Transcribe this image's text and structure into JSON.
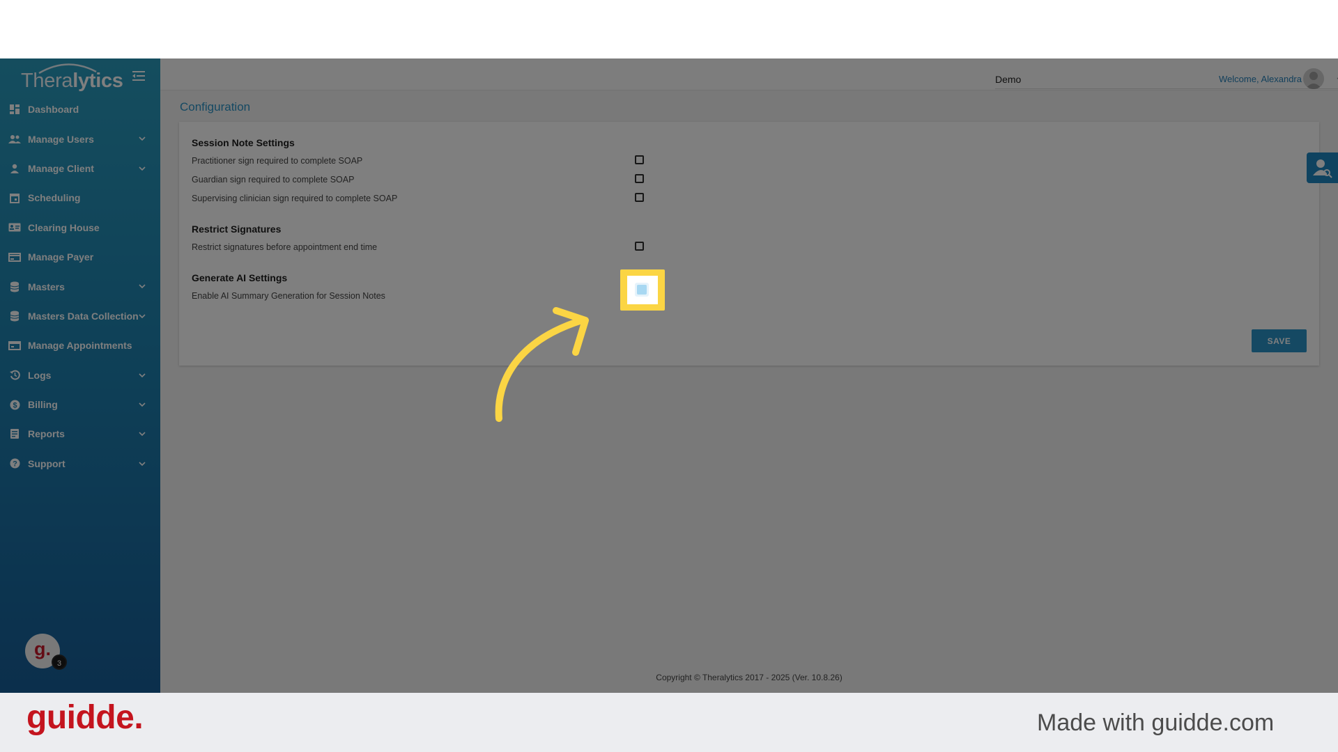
{
  "app": {
    "logo_prefix": "Thera",
    "logo_suffix": "lytics"
  },
  "sidebar": {
    "items": [
      {
        "label": "Dashboard",
        "icon": "dashboard-icon",
        "expandable": false
      },
      {
        "label": "Manage Users",
        "icon": "users-icon",
        "expandable": true
      },
      {
        "label": "Manage Client",
        "icon": "person-icon",
        "expandable": true
      },
      {
        "label": "Scheduling",
        "icon": "calendar-icon",
        "expandable": false
      },
      {
        "label": "Clearing House",
        "icon": "id-card-icon",
        "expandable": false
      },
      {
        "label": "Manage Payer",
        "icon": "payer-card-icon",
        "expandable": false
      },
      {
        "label": "Masters",
        "icon": "database-icon",
        "expandable": true
      },
      {
        "label": "Masters Data Collection",
        "icon": "database-icon",
        "expandable": true
      },
      {
        "label": "Manage Appointments",
        "icon": "appointments-icon",
        "expandable": false
      },
      {
        "label": "Logs",
        "icon": "history-icon",
        "expandable": true
      },
      {
        "label": "Billing",
        "icon": "dollar-icon",
        "expandable": true
      },
      {
        "label": "Reports",
        "icon": "report-icon",
        "expandable": true
      },
      {
        "label": "Support",
        "icon": "help-icon",
        "expandable": true
      }
    ],
    "avatar_letter": "g.",
    "avatar_badge": "3"
  },
  "header": {
    "organization": "Demo",
    "welcome": "Welcome, Alexandra"
  },
  "page": {
    "title": "Configuration"
  },
  "settings": {
    "session_note": {
      "title": "Session Note Settings",
      "options": [
        {
          "label": "Practitioner sign required to complete SOAP",
          "checked": false
        },
        {
          "label": "Guardian sign required to complete SOAP",
          "checked": false
        },
        {
          "label": "Supervising clinician sign required to complete SOAP",
          "checked": false
        }
      ]
    },
    "restrict_signatures": {
      "title": "Restrict Signatures",
      "options": [
        {
          "label": "Restrict signatures before appointment end time",
          "checked": false
        }
      ]
    },
    "generate_ai": {
      "title": "Generate AI Settings",
      "options": [
        {
          "label": "Enable AI Summary Generation for Session Notes",
          "checked": true
        }
      ]
    },
    "save_label": "SAVE"
  },
  "footer": {
    "copyright": "Copyright © Theralytics 2017 - 2025 (Ver. 10.8.26)"
  },
  "banner": {
    "brand": "guidde.",
    "made_with": "Made with guidde.com"
  },
  "colors": {
    "sidebar_top": "#2a9bbd",
    "sidebar_bottom": "#175e98",
    "accent": "#2a93c7",
    "highlight": "#fbd544",
    "brand_red": "#c4141e"
  }
}
